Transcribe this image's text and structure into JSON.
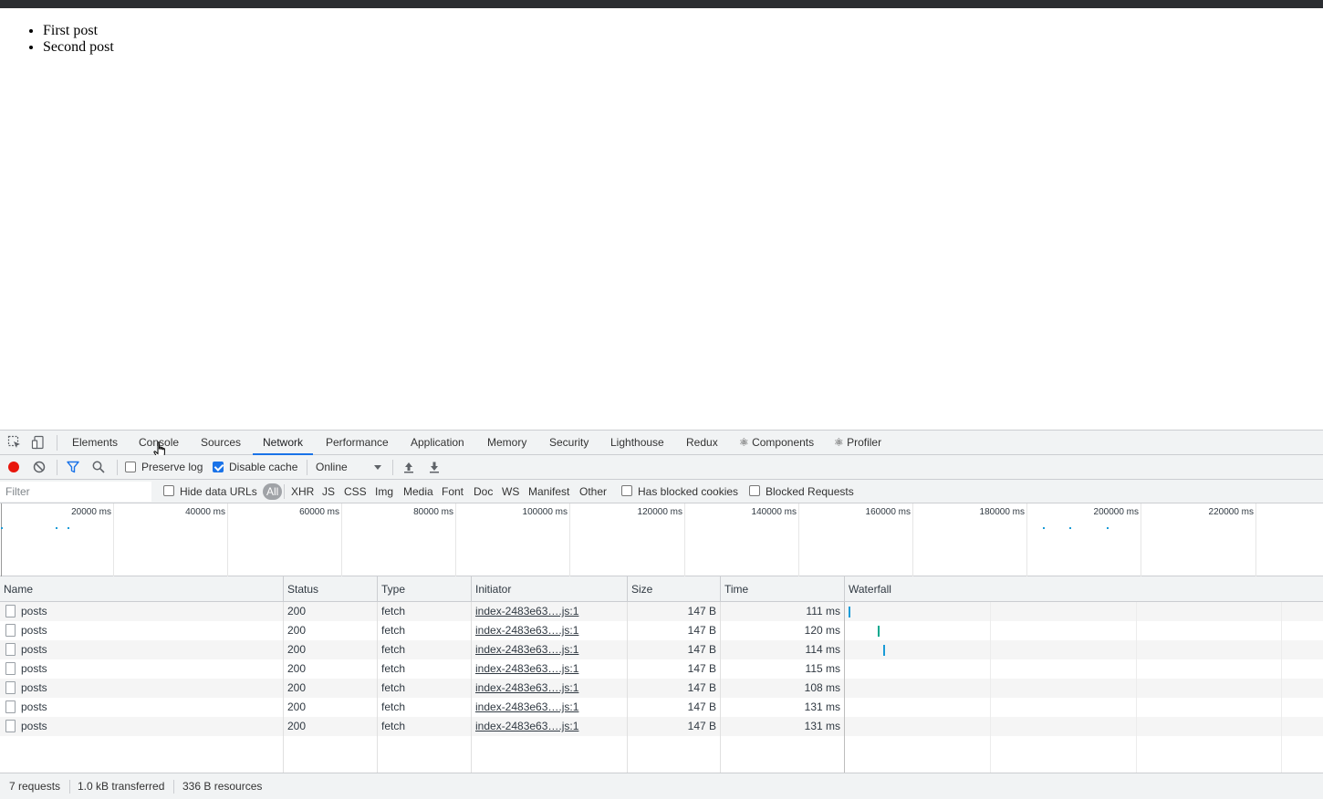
{
  "page": {
    "posts": [
      "First post",
      "Second post"
    ]
  },
  "devtools": {
    "tabs": [
      "Elements",
      "Console",
      "Sources",
      "Network",
      "Performance",
      "Application",
      "Memory",
      "Security",
      "Lighthouse",
      "Redux",
      "⚛ Components",
      "⚛ Profiler"
    ],
    "active_tab": "Network",
    "toolbar": {
      "preserve_log": "Preserve log",
      "preserve_log_checked": false,
      "disable_cache": "Disable cache",
      "disable_cache_checked": true,
      "throttling": "Online"
    },
    "filter": {
      "placeholder": "Filter",
      "hide_data_urls": "Hide data URLs",
      "types": [
        "All",
        "XHR",
        "JS",
        "CSS",
        "Img",
        "Media",
        "Font",
        "Doc",
        "WS",
        "Manifest",
        "Other"
      ],
      "active_type": "All",
      "has_blocked_cookies": "Has blocked cookies",
      "blocked_requests": "Blocked Requests"
    },
    "overview": {
      "ticks": [
        "20000 ms",
        "40000 ms",
        "60000 ms",
        "80000 ms",
        "100000 ms",
        "120000 ms",
        "140000 ms",
        "160000 ms",
        "180000 ms",
        "200000 ms",
        "220000 ms"
      ]
    },
    "table": {
      "columns": [
        "Name",
        "Status",
        "Type",
        "Initiator",
        "Size",
        "Time",
        "Waterfall"
      ],
      "rows": [
        {
          "name": "posts",
          "status": "200",
          "type": "fetch",
          "initiator": "index-2483e63….js:1",
          "size": "147 B",
          "time": "111 ms"
        },
        {
          "name": "posts",
          "status": "200",
          "type": "fetch",
          "initiator": "index-2483e63….js:1",
          "size": "147 B",
          "time": "120 ms"
        },
        {
          "name": "posts",
          "status": "200",
          "type": "fetch",
          "initiator": "index-2483e63….js:1",
          "size": "147 B",
          "time": "114 ms"
        },
        {
          "name": "posts",
          "status": "200",
          "type": "fetch",
          "initiator": "index-2483e63….js:1",
          "size": "147 B",
          "time": "115 ms"
        },
        {
          "name": "posts",
          "status": "200",
          "type": "fetch",
          "initiator": "index-2483e63….js:1",
          "size": "147 B",
          "time": "108 ms"
        },
        {
          "name": "posts",
          "status": "200",
          "type": "fetch",
          "initiator": "index-2483e63….js:1",
          "size": "147 B",
          "time": "131 ms"
        },
        {
          "name": "posts",
          "status": "200",
          "type": "fetch",
          "initiator": "index-2483e63….js:1",
          "size": "147 B",
          "time": "131 ms"
        }
      ]
    },
    "status": {
      "requests": "7 requests",
      "transferred": "1.0 kB transferred",
      "resources": "336 B resources"
    },
    "colors": {
      "accent": "#1a73e8",
      "record": "#e8160c",
      "waterfall_blue": "#1a9bd7",
      "waterfall_teal": "#00a88e"
    }
  }
}
